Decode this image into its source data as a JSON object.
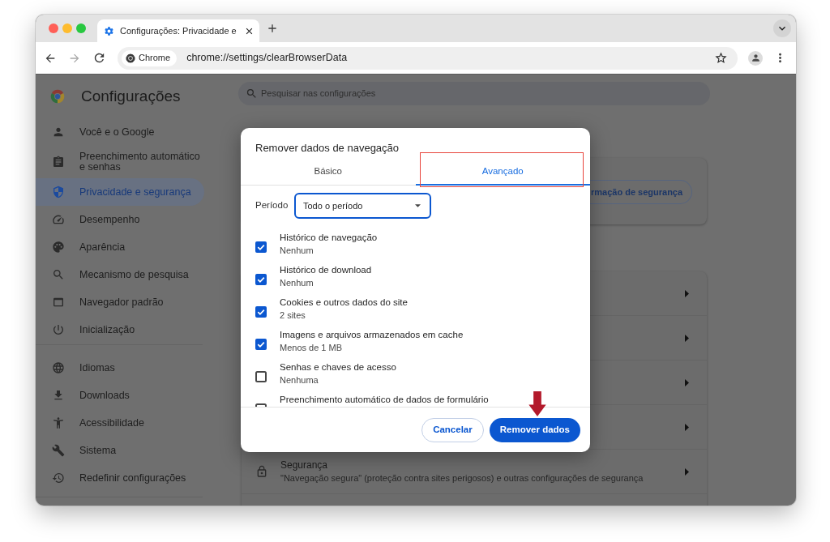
{
  "browser": {
    "tab": {
      "title": "Configurações: Privacidade e"
    },
    "address_bar": {
      "chip": "Chrome",
      "url": "chrome://settings/clearBrowserData"
    }
  },
  "sidebar": {
    "title": "Configurações",
    "sections": [
      {
        "items": [
          {
            "label": "Você e o Google",
            "selected": false
          },
          {
            "label": "Preenchimento automático e senhas",
            "selected": false
          },
          {
            "label": "Privacidade e segurança",
            "selected": true
          },
          {
            "label": "Desempenho",
            "selected": false
          },
          {
            "label": "Aparência",
            "selected": false
          },
          {
            "label": "Mecanismo de pesquisa",
            "selected": false
          },
          {
            "label": "Navegador padrão",
            "selected": false
          },
          {
            "label": "Inicialização",
            "selected": false
          }
        ]
      },
      {
        "items": [
          {
            "label": "Idiomas",
            "selected": false
          },
          {
            "label": "Downloads",
            "selected": false
          },
          {
            "label": "Acessibilidade",
            "selected": false
          },
          {
            "label": "Sistema",
            "selected": false
          },
          {
            "label": "Redefinir configurações",
            "selected": false
          }
        ]
      }
    ]
  },
  "search": {
    "placeholder": "Pesquisar nas configurações"
  },
  "safety_card": {
    "button": "rmação de segurança"
  },
  "privacy_list": {
    "rows": [
      {
        "kind": "covered"
      },
      {
        "kind": "covered"
      },
      {
        "kind": "covered"
      },
      {
        "kind": "covered"
      },
      {
        "kind": "entry",
        "title": "Segurança",
        "subtitle": "\"Navegação segura\" (proteção contra sites perigosos) e outras configurações de segurança"
      }
    ]
  },
  "dialog": {
    "title": "Remover dados de navegação",
    "tabs": [
      {
        "label": "Básico",
        "selected": false
      },
      {
        "label": "Avançado",
        "selected": true
      }
    ],
    "period": {
      "label": "Período",
      "value": "Todo o período"
    },
    "options": [
      {
        "title": "Histórico de navegação",
        "subtitle": "Nenhum",
        "checked": true
      },
      {
        "title": "Histórico de download",
        "subtitle": "Nenhum",
        "checked": true
      },
      {
        "title": "Cookies e outros dados do site",
        "subtitle": "2 sites",
        "checked": true
      },
      {
        "title": "Imagens e arquivos armazenados em cache",
        "subtitle": "Menos de 1 MB",
        "checked": true
      },
      {
        "title": "Senhas e chaves de acesso",
        "subtitle": "Nenhuma",
        "checked": false
      },
      {
        "title": "Preenchimento automático de dados de formulário",
        "checked": false
      }
    ],
    "buttons": [
      {
        "label": "Cancelar",
        "kind": "cancel"
      },
      {
        "label": "Remover dados",
        "kind": "confirm"
      }
    ]
  }
}
